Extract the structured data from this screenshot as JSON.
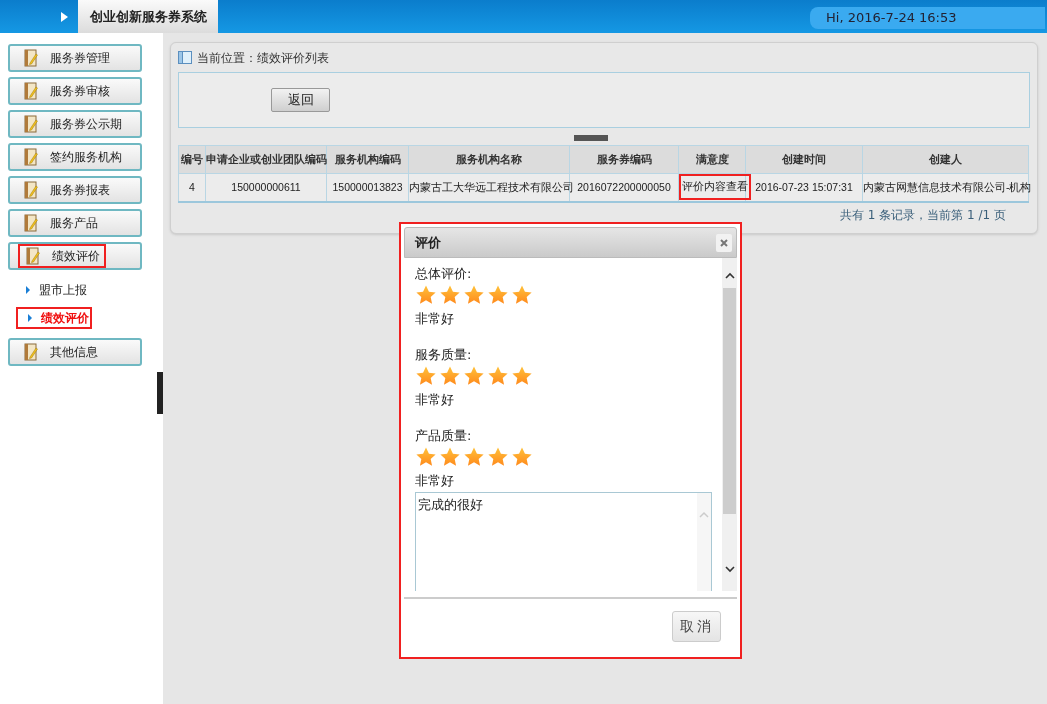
{
  "header": {
    "title": "创业创新服务券系统",
    "greeting": "Hi, 2016-7-24 16:53"
  },
  "sidebar": {
    "items": [
      {
        "label": "服务券管理",
        "highlighted": false
      },
      {
        "label": "服务券审核",
        "highlighted": false
      },
      {
        "label": "服务券公示期",
        "highlighted": false
      },
      {
        "label": "签约服务机构",
        "highlighted": false
      },
      {
        "label": "服务券报表",
        "highlighted": false
      },
      {
        "label": "服务产品",
        "highlighted": false
      },
      {
        "label": "绩效评价",
        "highlighted": true,
        "children": [
          {
            "label": "盟市上报",
            "selected": false
          },
          {
            "label": "绩效评价",
            "selected": true
          }
        ]
      },
      {
        "label": "其他信息",
        "highlighted": false
      }
    ]
  },
  "main": {
    "breadcrumb": "当前位置：绩效评价列表",
    "back_button": "返回",
    "table": {
      "columns": [
        "编号",
        "申请企业或创业团队编码",
        "服务机构编码",
        "服务机构名称",
        "服务券编码",
        "满意度",
        "创建时间",
        "创建人"
      ],
      "rows": [
        {
          "cells": [
            {
              "text": "4",
              "highlighted": false
            },
            {
              "text": "150000000611",
              "highlighted": false
            },
            {
              "text": "150000013823",
              "highlighted": false
            },
            {
              "text": "内蒙古工大华远工程技术有限公司",
              "highlighted": false
            },
            {
              "text": "2016072200000050",
              "highlighted": false
            },
            {
              "text": "评价内容查看",
              "highlighted": true
            },
            {
              "text": "2016-07-23 15:07:31",
              "highlighted": false
            },
            {
              "text": "内蒙古网慧信息技术有限公司-机构",
              "highlighted": false
            }
          ]
        }
      ]
    },
    "pagination": "共有 1 条记录，当前第 1 /1 页"
  },
  "dialog": {
    "title": "评价",
    "highlighted": true,
    "sections": [
      {
        "label": "总体评价:",
        "stars": 5,
        "rating_text": "非常好"
      },
      {
        "label": "服务质量:",
        "stars": 5,
        "rating_text": "非常好"
      },
      {
        "label": "产品质量:",
        "stars": 5,
        "rating_text": "非常好"
      }
    ],
    "comment": "完成的很好",
    "cancel_button": "取消"
  }
}
